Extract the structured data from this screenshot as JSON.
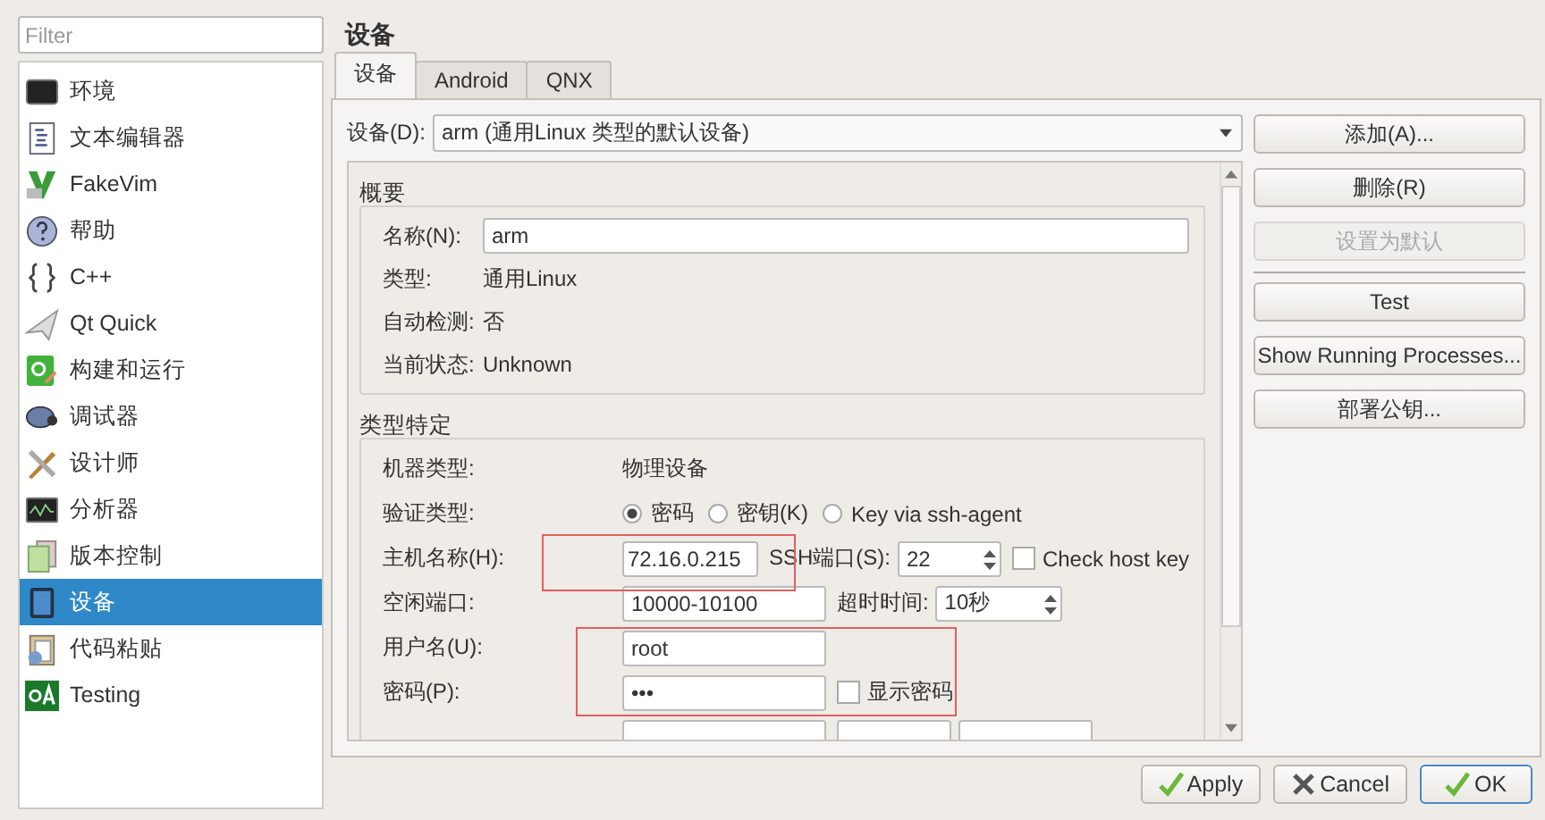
{
  "filter": {
    "placeholder": "Filter"
  },
  "sidebar": {
    "items": [
      {
        "label": "环境",
        "selected": false
      },
      {
        "label": "文本编辑器",
        "selected": false
      },
      {
        "label": "FakeVim",
        "selected": false
      },
      {
        "label": "帮助",
        "selected": false
      },
      {
        "label": "C++",
        "selected": false
      },
      {
        "label": "Qt Quick",
        "selected": false
      },
      {
        "label": "构建和运行",
        "selected": false
      },
      {
        "label": "调试器",
        "selected": false
      },
      {
        "label": "设计师",
        "selected": false
      },
      {
        "label": "分析器",
        "selected": false
      },
      {
        "label": "版本控制",
        "selected": false
      },
      {
        "label": "设备",
        "selected": true
      },
      {
        "label": "代码粘贴",
        "selected": false
      },
      {
        "label": "Testing",
        "selected": false
      }
    ]
  },
  "page_title": "设备",
  "tabs": [
    {
      "label": "设备",
      "selected": true
    },
    {
      "label": "Android",
      "selected": false
    },
    {
      "label": "QNX",
      "selected": false
    }
  ],
  "device": {
    "label": "设备(D):",
    "value": "arm (通用Linux 类型的默认设备)"
  },
  "summary": {
    "title": "概要",
    "name": {
      "label": "名称(N):",
      "value": "arm"
    },
    "rows": [
      {
        "label": "类型:",
        "value": "通用Linux"
      },
      {
        "label": "自动检测:",
        "value": "否"
      },
      {
        "label": "当前状态:",
        "value": "Unknown"
      }
    ]
  },
  "specific": {
    "title": "类型特定",
    "machine_type": {
      "label": "机器类型:",
      "value": "物理设备"
    },
    "auth": {
      "label": "验证类型:",
      "options": [
        {
          "label": "密码",
          "selected": true
        },
        {
          "label": "密钥(K)",
          "selected": false
        },
        {
          "label": "Key via ssh-agent",
          "selected": false
        }
      ]
    },
    "host": {
      "label": "主机名称(H):",
      "value": "72.16.0.215"
    },
    "ssh_port": {
      "label": "SSH端口(S):",
      "value": "22"
    },
    "check_host_key": {
      "label": "Check host key",
      "checked": false
    },
    "free_ports": {
      "label": "空闲端口:",
      "value": "10000-10100"
    },
    "timeout": {
      "label": "超时时间:",
      "value": "10秒"
    },
    "user": {
      "label": "用户名(U):",
      "value": "root"
    },
    "password": {
      "label": "密码(P):",
      "value": "•••"
    },
    "show_password": {
      "label": "显示密码",
      "checked": false
    }
  },
  "device_buttons": [
    {
      "label": "添加(A)...",
      "disabled": false
    },
    {
      "label": "删除(R)",
      "disabled": false
    },
    {
      "label": "设置为默认",
      "disabled": true
    }
  ],
  "tool_buttons": [
    {
      "label": "Test",
      "disabled": false
    },
    {
      "label": "Show Running Processes...",
      "disabled": false
    },
    {
      "label": "部署公钥...",
      "disabled": false
    }
  ],
  "footer_buttons": [
    {
      "label": "Apply",
      "kind": "apply",
      "default": false
    },
    {
      "label": "Cancel",
      "kind": "cancel",
      "default": false
    },
    {
      "label": "OK",
      "kind": "ok",
      "default": true
    }
  ]
}
